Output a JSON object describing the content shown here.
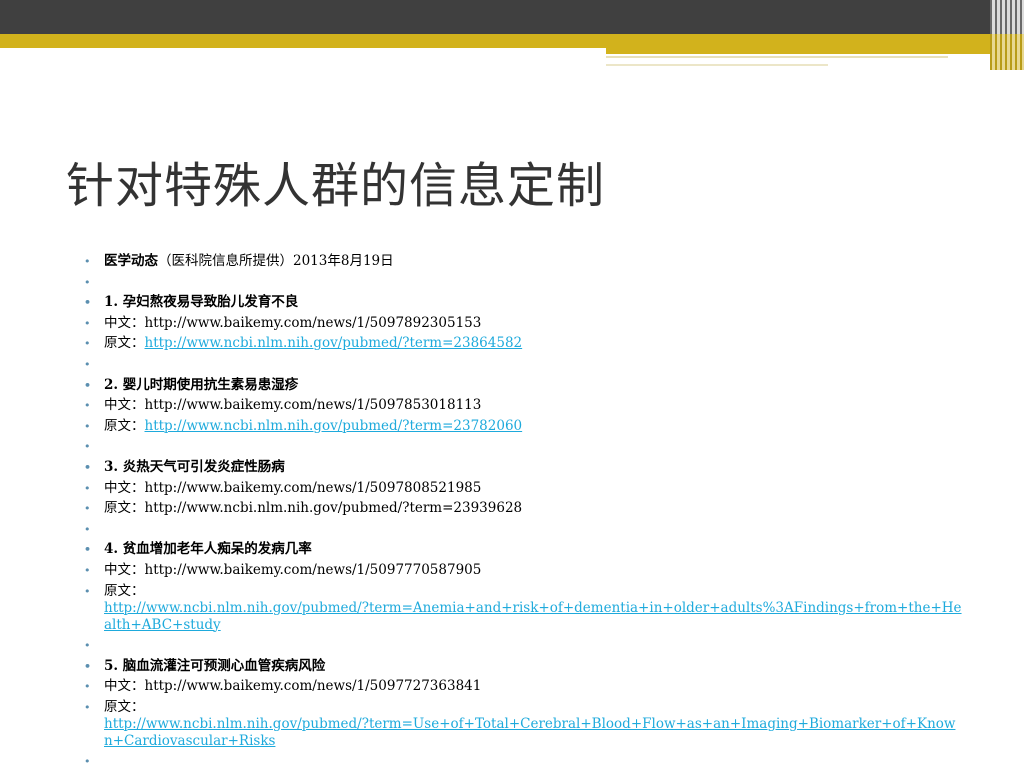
{
  "title": "针对特殊人群的信息定制",
  "header": {
    "source_label": "医学动态",
    "source_detail": "（医科院信息所提供）2013年8月19日"
  },
  "labels": {
    "cn": "中文：",
    "orig": "原文："
  },
  "articles": [
    {
      "heading": "1. 孕妇熬夜易导致胎儿发育不良",
      "cn_url": "http://www.baikemy.com/news/1/5097892305153",
      "orig_url": "http://www.ncbi.nlm.nih.gov/pubmed/?term=23864582"
    },
    {
      "heading": "2. 婴儿时期使用抗生素易患湿疹",
      "cn_url": "http://www.baikemy.com/news/1/5097853018113",
      "orig_url": "http://www.ncbi.nlm.nih.gov/pubmed/?term=23782060"
    },
    {
      "heading": "3. 炎热天气可引发炎症性肠病",
      "cn_url": "http://www.baikemy.com/news/1/5097808521985",
      "orig_url": "http://www.ncbi.nlm.nih.gov/pubmed/?term=23939628"
    },
    {
      "heading": "4. 贫血增加老年人痴呆的发病几率",
      "cn_url": "http://www.baikemy.com/news/1/5097770587905",
      "orig_url": "http://www.ncbi.nlm.nih.gov/pubmed/?term=Anemia+and+risk+of+dementia+in+older+adults%3AFindings+from+the+Health+ABC+study"
    },
    {
      "heading": "5. 脑血流灌注可预测心血管疾病风险",
      "cn_url": "http://www.baikemy.com/news/1/5097727363841",
      "orig_url": "http://www.ncbi.nlm.nih.gov/pubmed/?term=Use+of+Total+Cerebral+Blood+Flow+as+an+Imaging+Biomarker+of+Known+Cardiovascular+Risks"
    }
  ],
  "colors": {
    "top_bar": "#404040",
    "accent_gold": "#d2b21c",
    "link": "#1eaadc",
    "bullet": "#5b8fb0"
  }
}
